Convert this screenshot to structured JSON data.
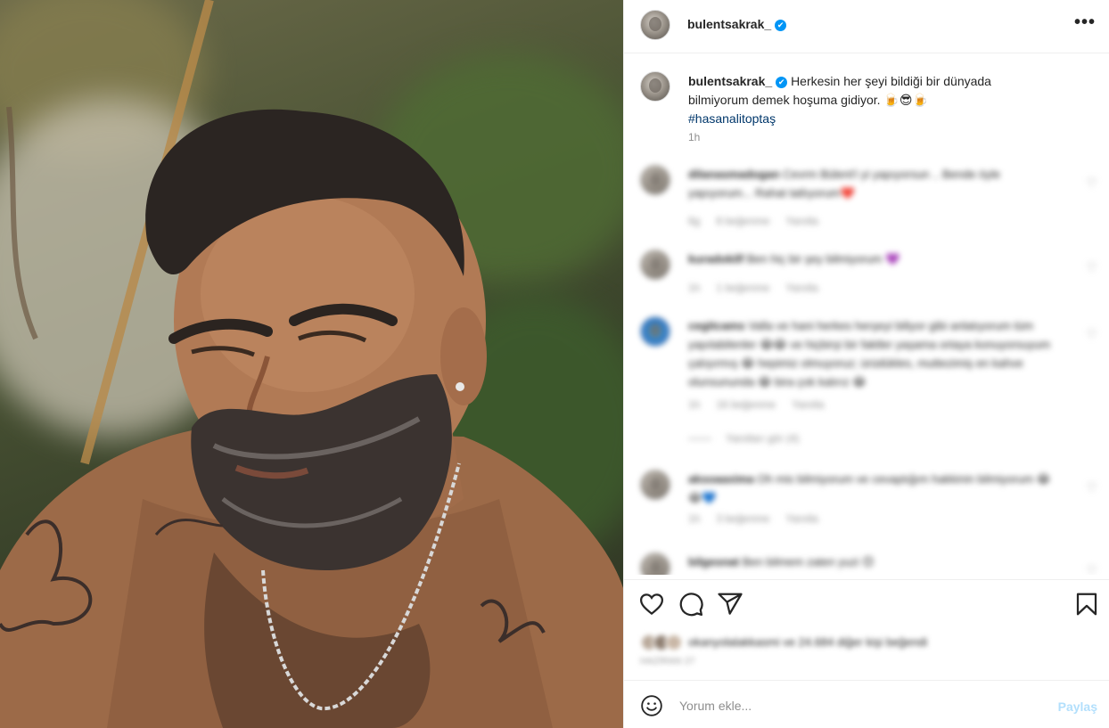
{
  "post": {
    "username": "bulentsakrak_",
    "verified_mark": "✔",
    "more_icon": "more-horizontal-icon",
    "caption_text": "Herkesin her şeyi bildiği bir dünyada bilmiyorum demek hoşuma gidiyor. 🍺😎🍺",
    "hashtag": "#hasanalitoptaş",
    "time": "1h",
    "photo": "photo of a bearded man with tattoos and a chain necklace, outdoors with green foliage"
  },
  "comments": [
    {
      "user": "dilanasmadogan",
      "text": "Cevrm Bülent'i yi yapıyorsun .. Bende öyle yapıyorum... Rahat tatlıyorum❤️",
      "time": "6g",
      "likes": "8 beğenme",
      "reply": "Yanıtla"
    },
    {
      "user": "kuradokilf",
      "text": "Ben hiç bir şey bilmiyorum 💜",
      "time": "1h",
      "likes": "1 beğenme",
      "reply": "Yanıtla"
    },
    {
      "user": "cegitcams",
      "text": "Valla ve hani herkes herşeyi biliyor gibi anlatıyorum tüm yapılabilenler 😂😂 ve hiçbirşi bir faktler yaşama ortaya konuyorsuyum çalışırmış 😂 hepimiz olmuyoruz; ürüdükles, muttezimiş en kahve olunsununda 😂 bira çok kalırız 😂",
      "time": "1h",
      "likes": "16 beğenme",
      "reply": "Yanıtla",
      "view_replies": "Yanıtları gör (4)"
    },
    {
      "user": "aksoaaxima",
      "text": "Oh mis bilmiyorum ve cevaptığım hakkinin bilmiyorum 😂😂💙",
      "time": "1h",
      "likes": "3 beğenme",
      "reply": "Yanıtla"
    },
    {
      "user": "bilgesnat",
      "text": "Ben bilmem zaten yuzi 😊",
      "time": "1h",
      "likes": "",
      "reply": ""
    }
  ],
  "actions": {
    "like_icon": "heart-icon",
    "comment_icon": "comment-bubble-icon",
    "share_icon": "paper-plane-icon",
    "save_icon": "bookmark-icon",
    "likes_text": "okanyolalakkasmi ve 24.684 diğer kişi beğendi",
    "date": "HAZİRAN 27"
  },
  "add_comment": {
    "emoji_icon": "emoji-smiley-icon",
    "placeholder": "Yorum ekle...",
    "post_label": "Paylaş"
  },
  "colors": {
    "verified": "#0095f6",
    "hashtag": "#00376b",
    "post_button_disabled": "#b2dffc",
    "secondary_text": "#8e8e8e"
  }
}
